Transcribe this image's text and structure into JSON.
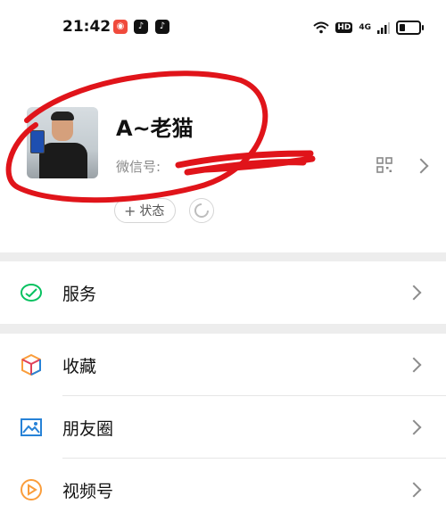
{
  "status_bar": {
    "time": "21:42",
    "app_badges": [
      "app-badge-red",
      "tiktok-badge",
      "tiktok-badge"
    ],
    "hd": "HD",
    "network": "4G"
  },
  "profile": {
    "nickname": "A~老猫",
    "wechat_id_label": "微信号:",
    "status_button": "状态"
  },
  "menu": {
    "services": "服务",
    "favorites": "收藏",
    "moments": "朋友圈",
    "channels": "视频号"
  },
  "colors": {
    "scribble": "#e0141a",
    "services_icon": "#07c160",
    "favorites_icon": "#fa9d3b",
    "moments_icon": "#2782d7",
    "channels_icon": "#fa9d3b"
  }
}
